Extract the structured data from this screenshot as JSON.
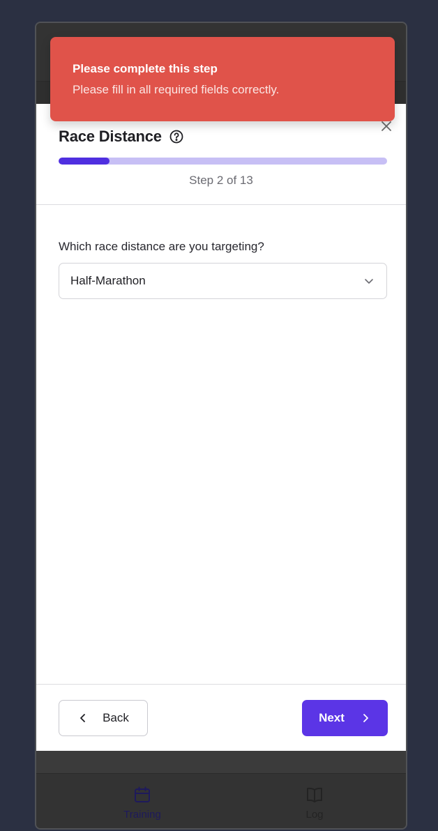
{
  "toast": {
    "title": "Please complete this step",
    "message": "Please fill in all required fields correctly.",
    "color": "#e0534a"
  },
  "modal": {
    "title": "Race Distance",
    "help_icon": "help-circle-icon",
    "close_icon": "close-icon",
    "progress": {
      "current": 2,
      "total": 13,
      "fraction": 0.154
    },
    "step_text": "Step 2 of 13",
    "question": "Which race distance are you targeting?",
    "select": {
      "value": "Half-Marathon",
      "icon": "chevron-down-icon"
    },
    "back_label": "Back",
    "next_label": "Next",
    "accent_color": "#5b35e6"
  },
  "tabbar": {
    "tabs": [
      {
        "label": "Training",
        "icon": "calendar-icon",
        "active": true
      },
      {
        "label": "Log",
        "icon": "book-icon",
        "active": false
      }
    ]
  }
}
